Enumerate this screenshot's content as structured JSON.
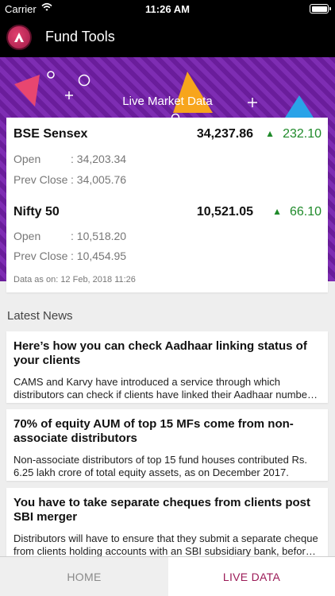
{
  "status": {
    "carrier": "Carrier",
    "time": "11:26 AM"
  },
  "app": {
    "title": "Fund Tools"
  },
  "banner": {
    "title": "Live Market Data"
  },
  "market": {
    "indices": [
      {
        "name": "BSE Sensex",
        "value": "34,237.86",
        "change": "232.10",
        "open_label": "Open",
        "open": ": 34,203.34",
        "prev_label": "Prev Close",
        "prev": ": 34,005.76"
      },
      {
        "name": "Nifty 50",
        "value": "10,521.05",
        "change": "66.10",
        "open_label": "Open",
        "open": ": 10,518.20",
        "prev_label": "Prev Close",
        "prev": ": 10,454.95"
      }
    ],
    "as_of": "Data as on: 12 Feb, 2018 11:26"
  },
  "news": {
    "heading": "Latest News",
    "items": [
      {
        "title": "Here’s how you can check Aadhaar linking status of your clients",
        "body": "CAMS and Karvy have introduced a service through which distributors can check if clients have linked their Aadhaar number with their folios."
      },
      {
        "title": "70% of equity AUM of top 15 MFs come from non-associate distributors",
        "body": "Non-associate distributors of top 15 fund houses contributed Rs. 6.25 lakh crore of total equity assets, as on December 2017."
      },
      {
        "title": "You have to take separate cheques from clients post SBI merger",
        "body": "Distributors will have to ensure that they submit a separate cheque from clients holding accounts with an SBI subsidiary bank, before the merger."
      }
    ]
  },
  "tabs": {
    "home": "HOME",
    "live": "LIVE DATA"
  },
  "colors": {
    "accent": "#9b1a57",
    "up": "#1f8a2a",
    "banner": "#6a1d9b"
  }
}
